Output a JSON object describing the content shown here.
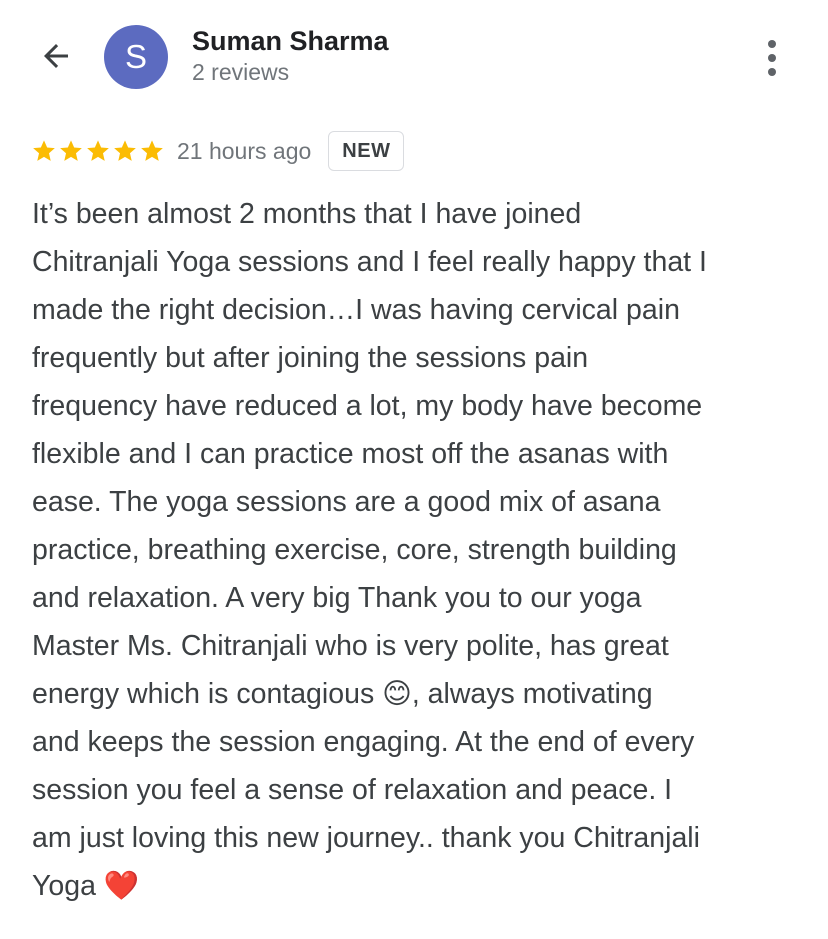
{
  "header": {
    "back_icon": "arrow-back-icon",
    "avatar_initial": "S",
    "avatar_color": "#5c6bc0",
    "author_name": "Suman Sharma",
    "review_count": "2 reviews",
    "more_icon": "more-vert-icon"
  },
  "review": {
    "rating": 5,
    "max_rating": 5,
    "star_color": "#fbbc04",
    "time_ago": "21 hours ago",
    "badge": "NEW",
    "text_lines": [
      "It’s been almost 2 months that I have joined",
      "Chitranjali Yoga sessions and I feel really happy that I",
      "made the right decision…I was having cervical pain",
      "frequently but after joining the sessions pain",
      "frequency have reduced a lot, my body have become",
      "flexible and I can practice most off the asanas with",
      "ease. The yoga sessions are a good mix of asana",
      "practice, breathing exercise, core, strength building",
      "and relaxation. A very big Thank you to our yoga",
      "Master Ms. Chitranjali who is very polite, has great",
      "energy which is contagious 😊, always motivating",
      "and keeps the session engaging. At the end of every",
      "session you feel a sense of relaxation and peace. I",
      "am just loving this new journey.. thank you Chitranjali",
      "Yoga ❤️"
    ]
  }
}
